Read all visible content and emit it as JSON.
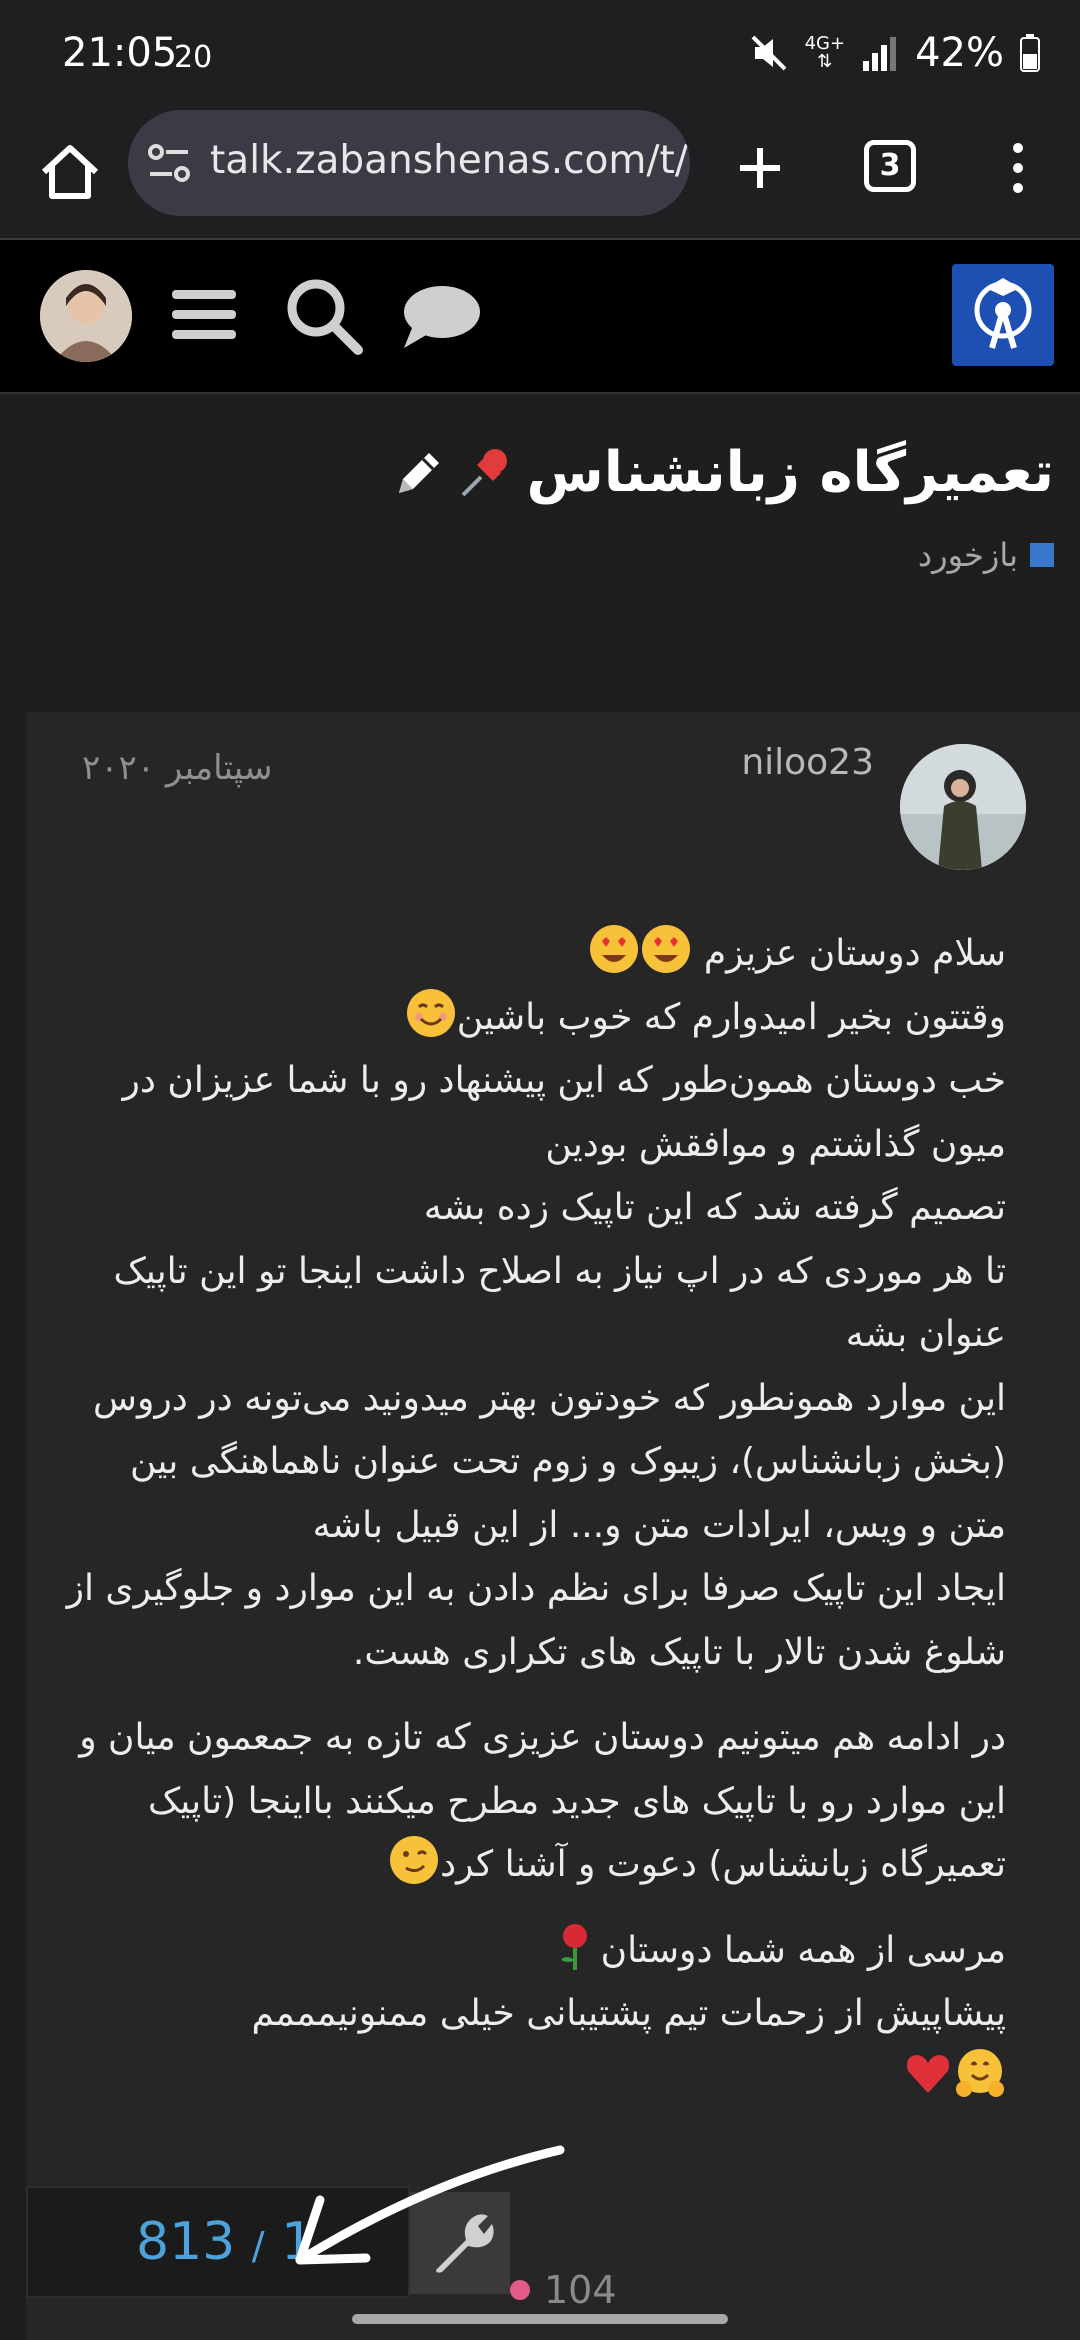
{
  "status_bar": {
    "time": "21:05",
    "seconds": "20",
    "network": "4G+",
    "battery": "42%"
  },
  "browser": {
    "url": "talk.zabanshenas.com/t/",
    "tab_count": "3"
  },
  "topic": {
    "title": "تعمیرگاه زبانشناس",
    "category": "بازخورد",
    "category_color": "#3a76c9"
  },
  "post": {
    "username": "niloo23",
    "date": "سپتامبر ۲۰۲۰",
    "paragraph1": [
      "سلام دوستان عزیزم",
      "وقتتون بخیر امیدوارم که خوب باشین",
      "خب دوستان همون‌طور که این پیشنهاد رو با شما عزیزان در میون گذاشتم و موافقش بودین",
      "تصمیم گرفته شد که این تاپیک زده بشه",
      "تا هر موردی که در اپ نیاز به اصلاح داشت اینجا تو این تاپیک عنوان بشه",
      "این موارد همونطور که خودتون بهتر میدونید می‌تونه در دروس (بخش زبانشناس)، زیبوک و زوم تحت عنوان ناهماهنگی بین متن و ویس، ایرادات متن و... از این قبیل باشه",
      "ایجاد این تاپیک صرفا برای نظم دادن به این موارد و جلوگیری از شلوغ شدن تالار با تاپیک های تکراری هست."
    ],
    "paragraph2": "در ادامه هم میتونیم دوستان عزیزی که تازه به جمعمون میان و این موارد رو با تاپیک های جدید مطرح میکنند بااینجا (تاپیک تعمیرگاه زبانشناس) دعوت و آشنا کرد",
    "paragraph3": [
      "مرسی از همه شما دوستان",
      "پیشاپیش از زحمات تیم پشتیبانی خیلی ممنونیمممم"
    ]
  },
  "timeline": {
    "current": "1",
    "separator": "/",
    "total": "813"
  },
  "likes": {
    "count": "104"
  },
  "colors": {
    "accent": "#4da3d9",
    "logo_bg": "#1e4fb3"
  }
}
